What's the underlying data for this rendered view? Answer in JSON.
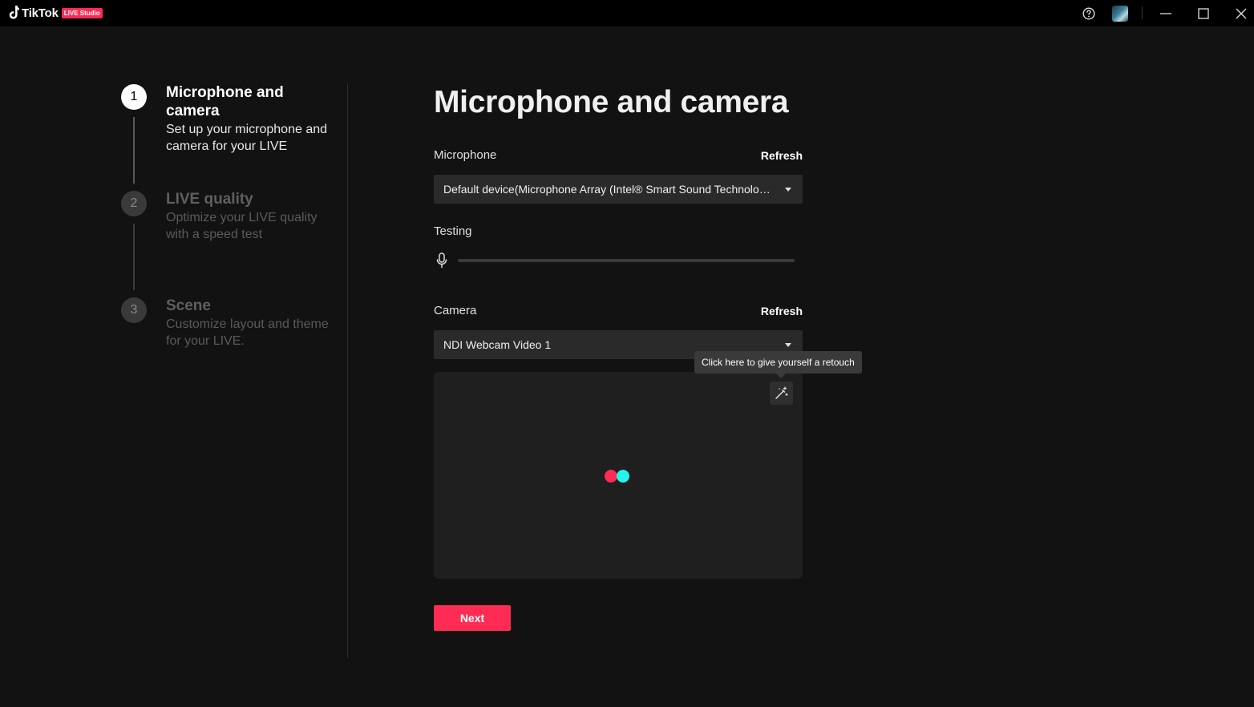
{
  "app": {
    "brand_name": "TikTok",
    "brand_badge": "LIVE Studio",
    "brand_color": "#fe2c55",
    "accent_cyan": "#25f4ee"
  },
  "titlebar": {
    "icons": [
      "help-icon",
      "avatar",
      "minimize-icon",
      "maximize-icon",
      "close-icon"
    ]
  },
  "steps": [
    {
      "number": "1",
      "title": "Microphone and camera",
      "description": "Set up your microphone and camera for your LIVE",
      "state": "active"
    },
    {
      "number": "2",
      "title": "LIVE quality",
      "description": "Optimize your LIVE quality with a speed test",
      "state": "inactive"
    },
    {
      "number": "3",
      "title": "Scene",
      "description": "Customize layout and theme for your LIVE.",
      "state": "inactive"
    }
  ],
  "main": {
    "title": "Microphone and camera",
    "microphone": {
      "label": "Microphone",
      "refresh_label": "Refresh",
      "selected": "Default device(Microphone Array (Intel® Smart Sound Technology for Digital Microphones))"
    },
    "testing": {
      "label": "Testing",
      "level": 0
    },
    "camera": {
      "label": "Camera",
      "refresh_label": "Refresh",
      "selected": "NDI Webcam Video 1"
    },
    "retouch_tooltip": "Click here to give yourself a retouch",
    "next_label": "Next"
  }
}
